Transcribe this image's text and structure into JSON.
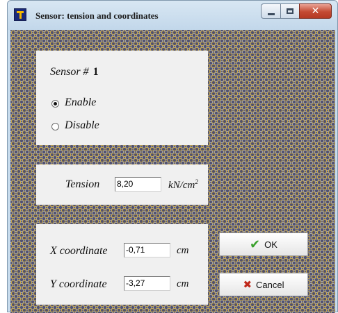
{
  "window": {
    "title": "Sensor: tension and coordinates"
  },
  "sensor": {
    "label": "Sensor #",
    "number": "1",
    "enable_label": "Enable",
    "disable_label": "Disable",
    "selected": "Enable"
  },
  "tension": {
    "label": "Tension",
    "value": "8,20",
    "unit": "kN/cm",
    "unit_sup": "2"
  },
  "coordinates": {
    "x_label": "X coordinate",
    "x_value": "-0,71",
    "x_unit": "cm",
    "y_label": "Y coordinate",
    "y_value": "-3,27",
    "y_unit": "cm"
  },
  "buttons": {
    "ok": "OK",
    "cancel": "Cancel"
  },
  "icons": {
    "app": "app-logo-icon",
    "minimize": "minimize-icon",
    "maximize": "maximize-icon",
    "close": "close-icon",
    "ok": "checkmark-icon",
    "cancel": "cancel-x-icon"
  }
}
